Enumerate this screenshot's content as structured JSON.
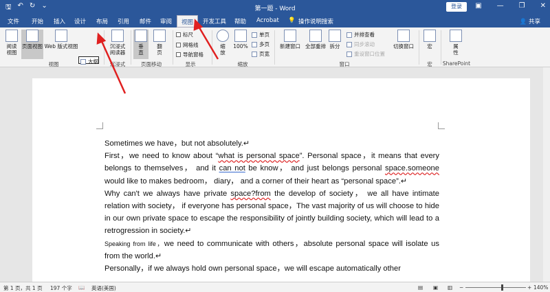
{
  "titlebar": {
    "title": "第一题 - Word",
    "login": "登录",
    "restore_icon": "restore-icon"
  },
  "tabs": [
    {
      "label": "文件"
    },
    {
      "label": "开始"
    },
    {
      "label": "插入"
    },
    {
      "label": "设计"
    },
    {
      "label": "布局"
    },
    {
      "label": "引用"
    },
    {
      "label": "邮件"
    },
    {
      "label": "审阅"
    },
    {
      "label": "视图"
    },
    {
      "label": "开发工具"
    },
    {
      "label": "帮助"
    },
    {
      "label": "Acrobat"
    },
    {
      "label": "操作说明搜索"
    }
  ],
  "share": "共享",
  "ribbon": {
    "views": {
      "read": "阅读\n视图",
      "print": "页面视图",
      "web": "Web 版式视图",
      "outline": "大纲",
      "draft": "草稿",
      "group": "视图"
    },
    "immersive": {
      "label": "沉浸式\n阅读器",
      "group": "沉浸式"
    },
    "pagemove": {
      "vertical": "垂\n直",
      "side": "翻\n页",
      "group": "页面移动"
    },
    "show": {
      "ruler": "标尺",
      "grid": "网格线",
      "nav": "导航窗格",
      "group": "显示"
    },
    "zoom": {
      "zoom": "缩\n放",
      "pct": "100%",
      "one": "单页",
      "multi": "多页",
      "width": "页宽",
      "group": "缩放"
    },
    "window": {
      "new": "新建窗口",
      "arrange": "全部重排",
      "split": "拆分",
      "side_by_side": "并排查看",
      "sync": "同步滚动",
      "reset": "重设窗口位置",
      "switch": "切换窗口",
      "group": "窗口"
    },
    "macro": {
      "label": "宏",
      "group": "宏"
    },
    "sp": {
      "label": "属\n性",
      "group": "SharePoint"
    }
  },
  "doc": {
    "l1": "Sometimes we have，but not absolutely.↵",
    "l2a": "First，we need to know about “",
    "l2b": "what is personal space",
    "l2c": "”. Personal space，it means that every belongs to themselves， and it ",
    "l2d": "can not",
    "l2e": " be know， and just belongs personal ",
    "l2f": "space.someone",
    "l2g": " would like to makes bedroom， diary， and a corner of their heart as “personal space”.↵",
    "l3a": "Why can't we always have private ",
    "l3b": "space?from",
    "l3c": " the develop of society， we all have intimate relation with society， if everyone has personal space，The vast majority of us will choose to hide in our own private space to escape the responsibility of jointly building society, which will lead to a retrogression in society.↵",
    "l4a": "Speaking from life，",
    "l4b": "we need to communicate with others，absolute personal space will isolate us from the world.↵",
    "l5": "Personally，if we always hold own personal space，we will escape automatically other"
  },
  "status": {
    "page": "第 1 页，共 1 页",
    "words": "197 个字",
    "lang": "英语(美国)",
    "zoom": "140%",
    "zoom_value": 0.56
  }
}
